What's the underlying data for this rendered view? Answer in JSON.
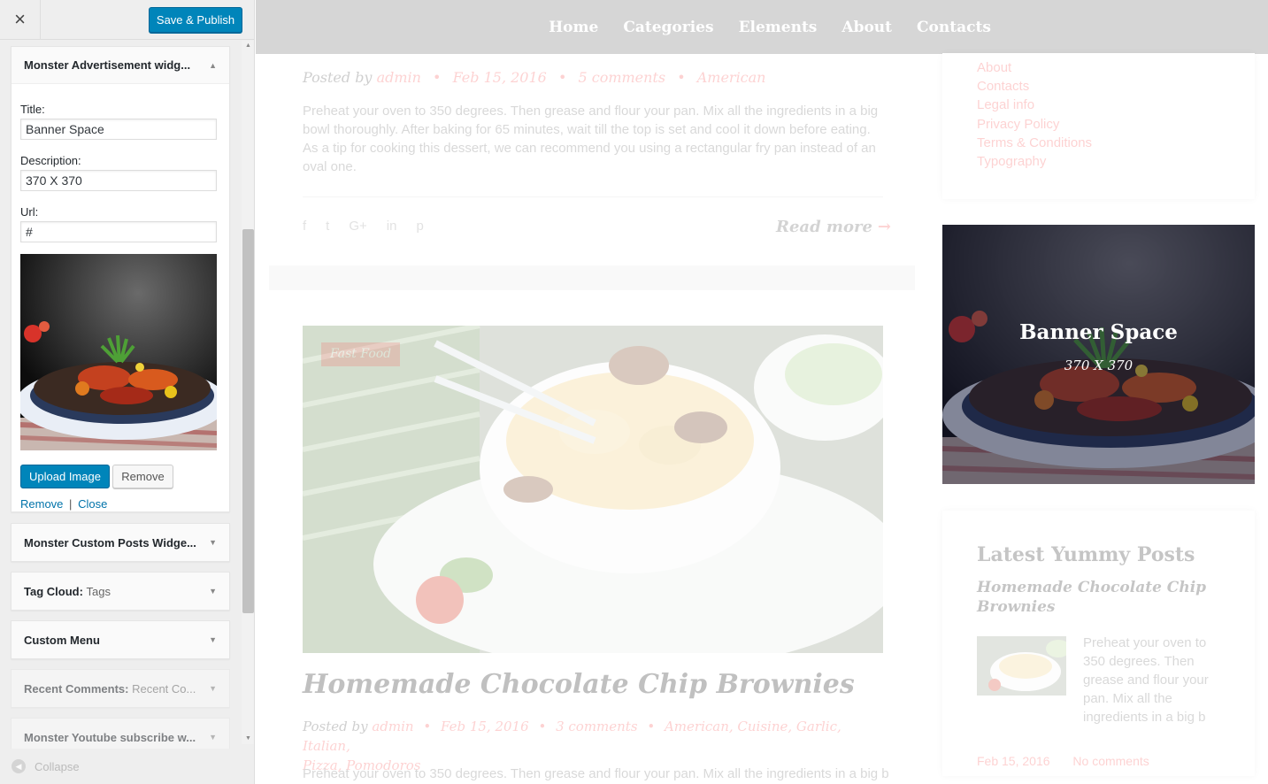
{
  "header": {
    "close_glyph": "×",
    "save_label": "Save & Publish"
  },
  "advert_widget": {
    "title": "Monster Advertisement widg...",
    "fields": {
      "title_label": "Title:",
      "title_value": "Banner Space",
      "description_label": "Description:",
      "description_value": "370 X 370",
      "url_label": "Url:",
      "url_value": "#"
    },
    "upload_label": "Upload Image",
    "remove_button_label": "Remove",
    "remove_link": "Remove",
    "separator": "|",
    "close_link": "Close"
  },
  "widgets": [
    {
      "title": "Monster Custom Posts Widge...",
      "subtitle": ""
    },
    {
      "title": "Tag Cloud:",
      "subtitle": "Tags"
    },
    {
      "title": "Custom Menu",
      "subtitle": ""
    },
    {
      "title": "Recent Comments:",
      "subtitle": "Recent Co..."
    },
    {
      "title": "Monster Youtube subscribe w...",
      "subtitle": ""
    }
  ],
  "collapse_label": "Collapse",
  "nav": [
    "Home",
    "Categories",
    "Elements",
    "About",
    "Contacts"
  ],
  "post1": {
    "posted_by": "Posted by",
    "author": "admin",
    "date": "Feb 15, 2016",
    "comments": "5 comments",
    "category": "American",
    "excerpt": "Preheat your oven to 350 degrees. Then grease and flour your pan. Mix all the ingredients in a big bowl thoroughly. After baking for 65 minutes, wait till the top is set and cool it down before eating. As a tip for cooking this dessert, we can recommend you using a rectangular fry pan instead of an oval one.",
    "social_icons": [
      "f",
      "t",
      "G+",
      "in",
      "p"
    ],
    "read_more": "Read more"
  },
  "post2": {
    "badge": "Fast Food",
    "title": "Homemade Chocolate Chip Brownies",
    "posted_by": "Posted by",
    "author": "admin",
    "date": "Feb 15, 2016",
    "comments": "3 comments",
    "categories": "American, Cuisine, Garlic, Italian,",
    "categories_line2": "Pizza, Pomodoros",
    "excerpt": "Preheat your oven to 350 degrees. Then grease and flour your pan. Mix all the ingredients in a big b"
  },
  "sidebar": {
    "links": [
      "About",
      "Contacts",
      "Legal info",
      "Privacy Policy",
      "Terms & Conditions",
      "Typography"
    ],
    "banner_title": "Banner Space",
    "banner_description": "370 X 370",
    "latest_title": "Latest Yummy Posts",
    "latest_post_title": "Homemade Chocolate Chip Brownies",
    "latest_excerpt": "Preheat your oven to 350 degrees. Then grease and flour your pan. Mix all the ingredients in a big b",
    "latest_date": "Feb 15, 2016",
    "latest_comments": "No comments"
  },
  "colors": {
    "primary_button": "#0085ba",
    "accent": "#f86262",
    "nav_bg": "#d6d6d6"
  }
}
